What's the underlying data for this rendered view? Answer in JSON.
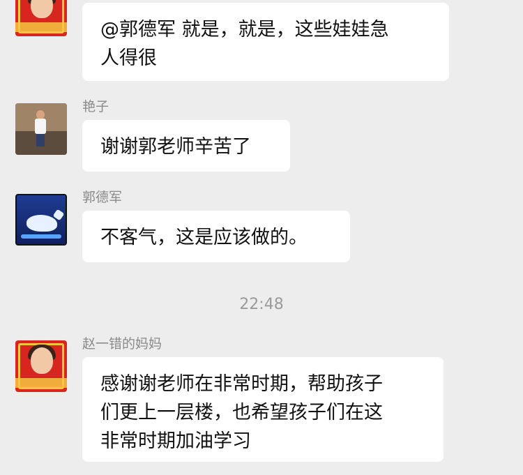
{
  "messages": [
    {
      "sender": "",
      "avatar": "red-framed-portrait-avatar",
      "text": "@郭德军 就是，就是，这些娃娃急\n人得很"
    },
    {
      "sender": "艳子",
      "avatar": "child-photo-avatar",
      "text": "谢谢郭老师辛苦了"
    },
    {
      "sender": "郭德军",
      "avatar": "whale-illustration-avatar",
      "text": "不客气，这是应该做的。"
    },
    {
      "sender": "赵一错的妈妈",
      "avatar": "red-framed-portrait-avatar",
      "text": "感谢谢老师在非常时期，帮助孩子\n们更上一层楼，也希望孩子们在这\n非常时期加油学习"
    }
  ],
  "timestamp": "22:48",
  "colors": {
    "background": "#ededed",
    "bubble": "#ffffff",
    "sender_name": "#8a8a8a",
    "timestamp": "#9a9a9a"
  }
}
